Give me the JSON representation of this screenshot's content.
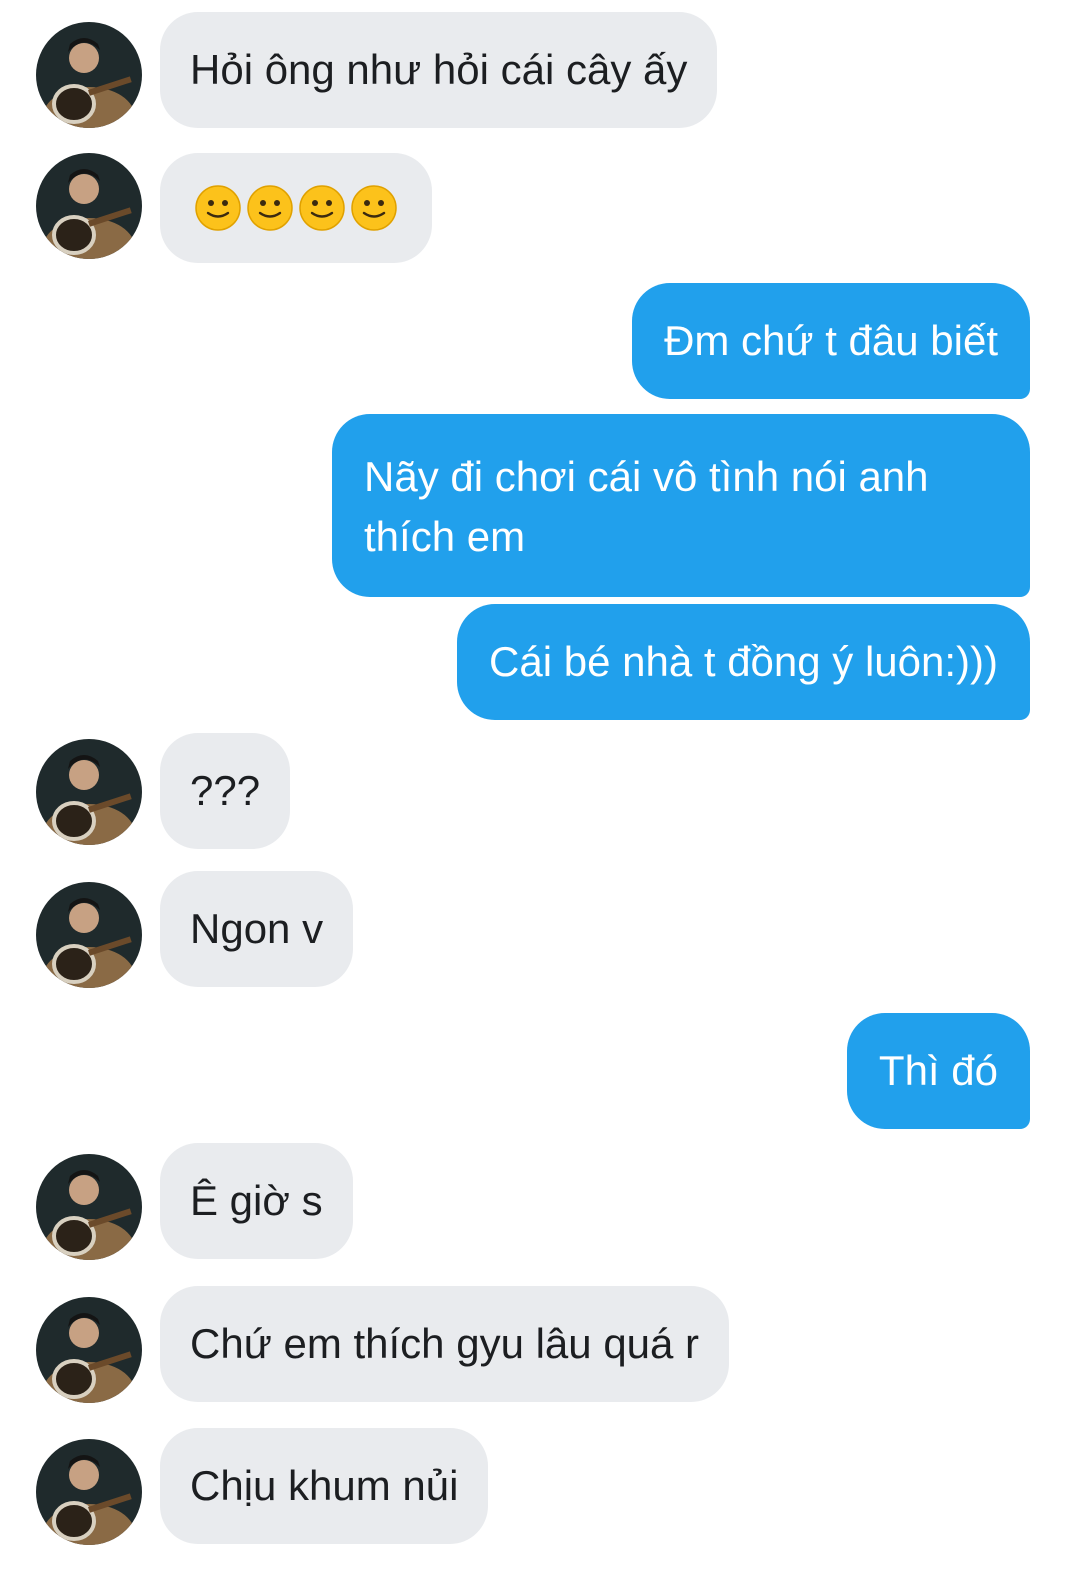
{
  "messages": [
    {
      "side": "in",
      "text": "Hỏi ông như hỏi cái cây ấy"
    },
    {
      "side": "in",
      "emoji": [
        "slightly-smiling-face",
        "slightly-smiling-face",
        "slightly-smiling-face",
        "slightly-smiling-face"
      ]
    },
    {
      "side": "out",
      "text": "Đm chứ t đâu biết"
    },
    {
      "side": "out",
      "text": "Nãy đi chơi cái vô tình nói anh thích em"
    },
    {
      "side": "out",
      "text": "Cái bé nhà t đồng ý luôn:)))"
    },
    {
      "side": "in",
      "text": "???"
    },
    {
      "side": "in",
      "text": "Ngon v"
    },
    {
      "side": "out",
      "text": "Thì đó"
    },
    {
      "side": "in",
      "text": "Ê giờ s"
    },
    {
      "side": "in",
      "text": "Chứ em thích gyu lâu quá r"
    },
    {
      "side": "in",
      "text": "Chịu khum nủi"
    }
  ],
  "colors": {
    "incoming_bubble": "#e9ebee",
    "incoming_text": "#1c1e21",
    "outgoing_bubble": "#21a0ec",
    "outgoing_text": "#ffffff"
  }
}
